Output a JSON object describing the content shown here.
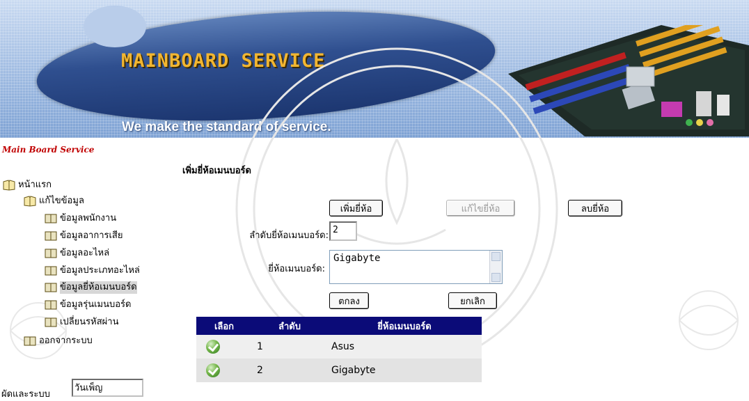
{
  "banner": {
    "title": "MAINBOARD SERVICE",
    "slogan": "We make the standard of service."
  },
  "sidebar": {
    "brand": "Main Board Service",
    "items": [
      {
        "label": "หน้าแรก"
      },
      {
        "label": "แก้ไขข้อมูล"
      },
      {
        "label": "ข้อมูลพนักงาน"
      },
      {
        "label": "ข้อมูลอาการเสีย"
      },
      {
        "label": "ข้อมูลอะไหล่"
      },
      {
        "label": "ข้อมูลประเภทอะไหล่"
      },
      {
        "label": "ข้อมูลยี่ห้อเมนบอร์ด"
      },
      {
        "label": "ข้อมูลรุ่นเมนบอร์ด"
      },
      {
        "label": "เปลี่ยนรหัสผ่าน"
      },
      {
        "label": "ออกจากระบบ"
      }
    ],
    "admin_label": "ผัดและระบบ",
    "admin_value": "วันเพ็ญ"
  },
  "main": {
    "heading": "เพิ่มยี่ห้อเมนบอร์ด",
    "add_button": "เพิ่มยี่ห้อ",
    "edit_button": "แก้ไขยี่ห้อ",
    "delete_button": "ลบยี่ห้อ",
    "seq_label": "ลำดับยี่ห้อเมนบอร์ด:",
    "seq_value": "2",
    "brand_label": "ยี่ห้อเมนบอร์ด:",
    "brand_value": "Gigabyte",
    "ok_button": "ตกลง",
    "cancel_button": "ยกเลิก"
  },
  "table": {
    "headers": [
      "เลือก",
      "ลำดับ",
      "ยี่ห้อเมนบอร์ด"
    ],
    "rows": [
      {
        "seq": "1",
        "brand": "Asus"
      },
      {
        "seq": "2",
        "brand": "Gigabyte"
      }
    ]
  },
  "colors": {
    "table_header": "#0b0b78",
    "brand": "#c00000",
    "title": "#f2b631"
  },
  "icons": {
    "tree_root": "open-book-icon",
    "tree_leaf": "book-icon",
    "select": "green-check-icon"
  }
}
